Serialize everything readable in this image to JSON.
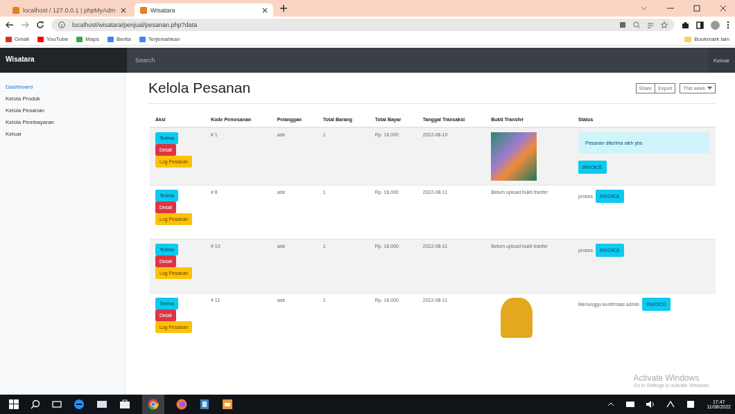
{
  "browser": {
    "tabs": [
      {
        "title": "localhost / 127.0.0.1 | phpMyAdm",
        "selected": false
      },
      {
        "title": "Wisatara",
        "selected": true
      }
    ],
    "address": "localhost/wisatara/penjual/pesanan.php?data",
    "bookmarks": [
      "Gmail",
      "YouTube",
      "Maps",
      "Berita",
      "Terjemahkan"
    ],
    "other_bookmarks": "Bookmark lain"
  },
  "navbar": {
    "brand": "Wisatara",
    "search": {
      "placeholder": "Search"
    },
    "sign_out": "Keluar"
  },
  "sidebar": {
    "items": [
      {
        "label": "Dashboard",
        "selected": true
      },
      {
        "label": "Kelola Produk",
        "selected": false
      },
      {
        "label": "Kelola Pesanan",
        "selected": false
      },
      {
        "label": "Kelola Pembayaran",
        "selected": false
      },
      {
        "label": "Keluar",
        "selected": false
      }
    ]
  },
  "page": {
    "title": "Kelola Pesanan",
    "toolbar": [
      "Share",
      "Export"
    ],
    "range": "This week"
  },
  "table": {
    "columns": [
      "Aksi",
      "Kode Pemesanan",
      "Pelanggan",
      "Total Barang",
      "Total Bayar",
      "Tanggal Transaksi",
      "Bukti Transfer",
      "Status"
    ],
    "rows": [
      {
        "actions": [
          {
            "label": "Terima",
            "kind": "info"
          },
          {
            "label": "Detail",
            "kind": "danger"
          },
          {
            "label": "Log Pesanan",
            "kind": "warning"
          }
        ],
        "code": "# 1",
        "customer": "ade",
        "items": "1",
        "total": "Rp. 16.000",
        "date": "2022-08-10",
        "proof": {
          "kind": "photo"
        },
        "status": {
          "kind": "alert",
          "text": "Pesanan diterima oleh ybs"
        },
        "invoice": "INVOICE"
      },
      {
        "actions": [
          {
            "label": "Terima",
            "kind": "info"
          },
          {
            "label": "Detail",
            "kind": "danger"
          },
          {
            "label": "Log Pesanan",
            "kind": "warning"
          }
        ],
        "code": "# 8",
        "customer": "ade",
        "items": "1",
        "total": "Rp. 16.000",
        "date": "2022-08-11",
        "proof": {
          "kind": "text",
          "text": "Belum upload bukti tranfer"
        },
        "status": {
          "kind": "inline",
          "text": "proses"
        },
        "invoice": "INVOICE"
      },
      {
        "actions": [
          {
            "label": "Terima",
            "kind": "info"
          },
          {
            "label": "Detail",
            "kind": "danger"
          },
          {
            "label": "Log Pesanan",
            "kind": "warning"
          }
        ],
        "code": "# 10",
        "customer": "ade",
        "items": "1",
        "total": "Rp. 16.000",
        "date": "2022-08-11",
        "proof": {
          "kind": "text",
          "text": "Belum upload bukti tranfer"
        },
        "status": {
          "kind": "inline",
          "text": "proses"
        },
        "invoice": "INVOICE"
      },
      {
        "actions": [
          {
            "label": "Terima",
            "kind": "info"
          },
          {
            "label": "Detail",
            "kind": "danger"
          },
          {
            "label": "Log Pesanan",
            "kind": "warning"
          }
        ],
        "code": "# 11",
        "customer": "ade",
        "items": "1",
        "total": "Rp. 16.000",
        "date": "2022-08-11",
        "proof": {
          "kind": "sticker"
        },
        "status": {
          "kind": "inline",
          "text": "Menunggu konfirmasi admin"
        },
        "invoice": "INVOICE"
      }
    ]
  },
  "activation": {
    "title": "Activate Windows",
    "hint": "Go to Settings to activate Windows."
  },
  "taskbar": {
    "time": "17:47",
    "date": "11/08/2022"
  }
}
